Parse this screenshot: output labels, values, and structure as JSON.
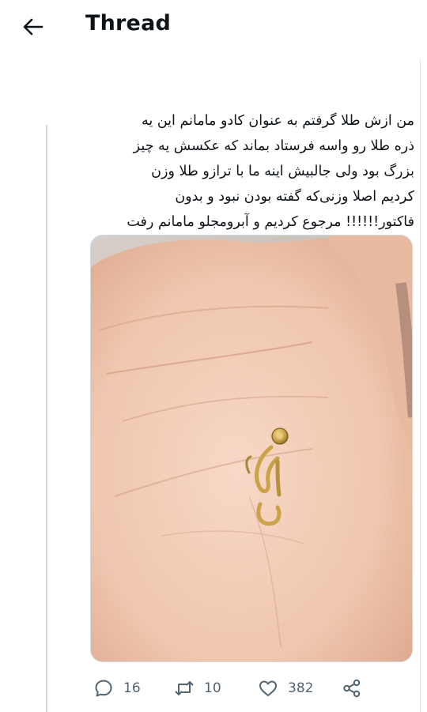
{
  "header": {
    "title": "Thread"
  },
  "tweet": {
    "lines": [
      "من ازش طلا گرفتم به عنوان کادو مامانم این یه",
      "ذره طلا رو واسه فرستاد بماند که عکسش یه چیز",
      "بزرگ بود ولی جالبیش اینه ما با ترازو طلا وزن",
      "کردیم اصلا وزنی‌که گفته بودن نبود و بدون",
      "فاکتور!!!!!! مرجوع کردیم  و آبرومجلو مامانم رفت"
    ]
  },
  "actions": {
    "replies": "16",
    "retweets": "10",
    "likes": "382"
  },
  "icons": [
    "back-arrow-icon",
    "reply-icon",
    "retweet-icon",
    "like-icon",
    "share-icon"
  ]
}
